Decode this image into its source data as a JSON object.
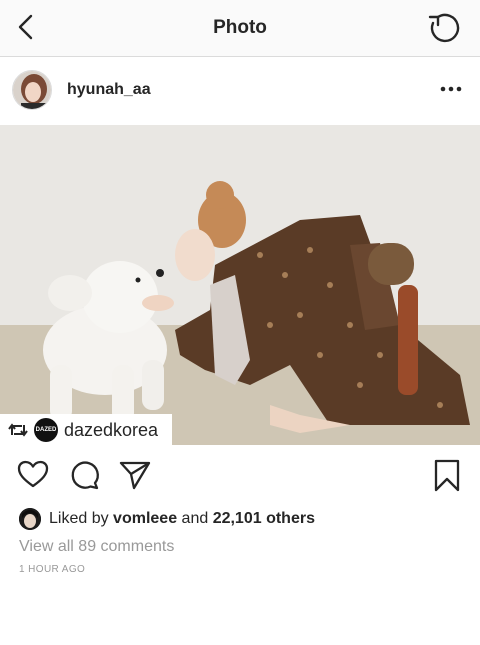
{
  "topbar": {
    "title": "Photo"
  },
  "post": {
    "username": "hyunah_aa",
    "tag_handle": "dazedkorea",
    "tag_logo_text": "DAZED",
    "liked_prefix": "Liked by ",
    "liked_user": "vomleee",
    "liked_and": " and ",
    "liked_others": "22,101 others",
    "view_comments": "View all 89 comments",
    "time_ago": "1 HOUR AGO"
  },
  "colors": {
    "text": "#262626",
    "muted": "#999999",
    "border": "#dbdbdb",
    "bar_bg": "#fafafa"
  },
  "icons": [
    "back-icon",
    "refresh-icon",
    "more-icon",
    "repost-icon",
    "heart-icon",
    "comment-icon",
    "share-icon",
    "bookmark-icon"
  ]
}
